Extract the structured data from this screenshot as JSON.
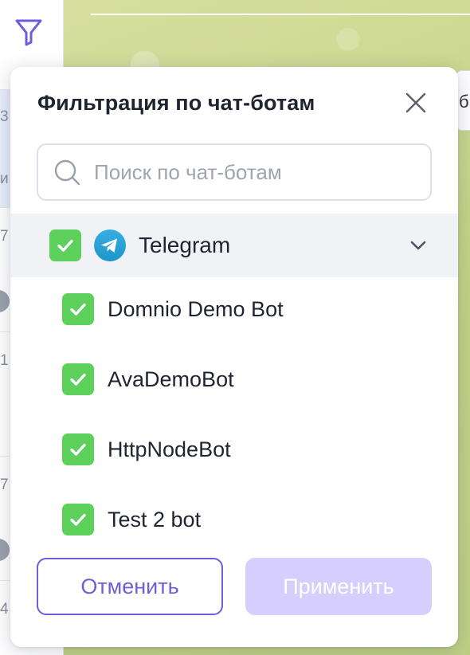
{
  "background": {
    "left_partial_texts": [
      "3",
      "и",
      "7",
      "1",
      "7",
      "4"
    ],
    "chat_search_partial": "б"
  },
  "modal": {
    "title": "Фильтрация по чат-ботам",
    "search": {
      "placeholder": "Поиск по чат-ботам",
      "value": ""
    },
    "group": {
      "label": "Telegram",
      "checked": true,
      "expanded": true
    },
    "bots": [
      {
        "label": "Domnio Demo Bot",
        "checked": true
      },
      {
        "label": "AvaDemoBot",
        "checked": true
      },
      {
        "label": "HttpNodeBot",
        "checked": true
      },
      {
        "label": "Test 2 bot",
        "checked": true
      }
    ],
    "cancel_label": "Отменить",
    "apply_label": "Применить"
  },
  "colors": {
    "accent": "#6b5fdc",
    "accent_disabled": "#d6cffd",
    "checkbox_green": "#5cd05a",
    "telegram_blue": "#2ea6de"
  }
}
